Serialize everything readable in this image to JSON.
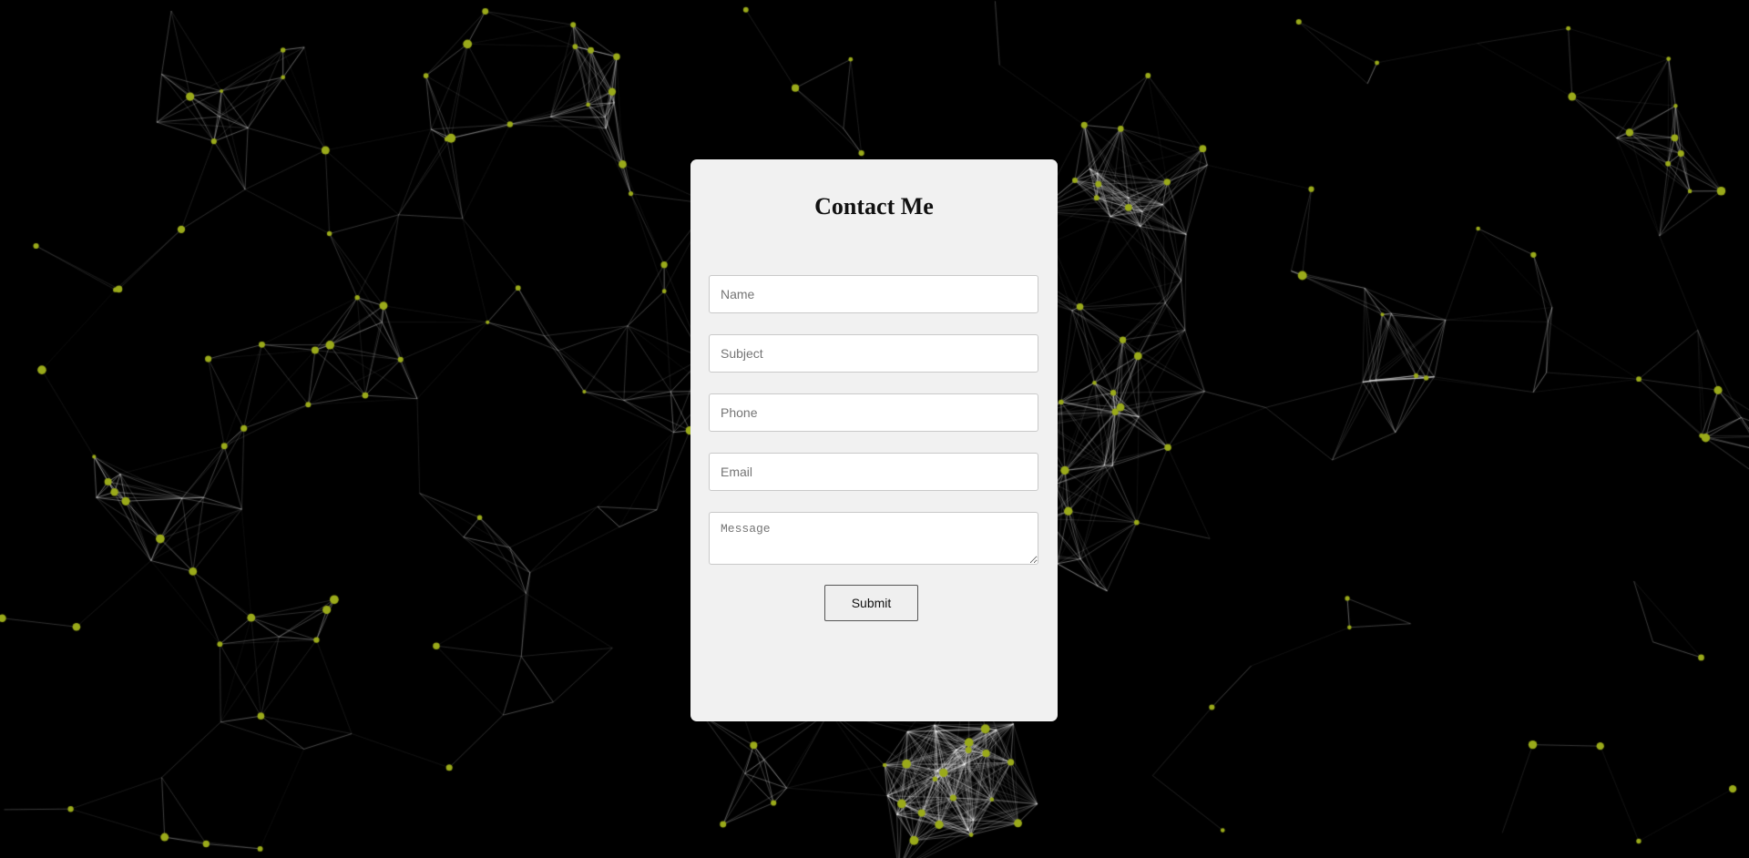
{
  "background": {
    "color": "#000000",
    "node_color": "#9aaa1a",
    "line_color": "#ffffff",
    "style": "particle-network"
  },
  "contact_form": {
    "title": "Contact Me",
    "fields": {
      "name": {
        "placeholder": "Name",
        "value": ""
      },
      "subject": {
        "placeholder": "Subject",
        "value": ""
      },
      "phone": {
        "placeholder": "Phone",
        "value": ""
      },
      "email": {
        "placeholder": "Email",
        "value": ""
      },
      "message": {
        "placeholder": "Message",
        "value": ""
      }
    },
    "submit_label": "Submit",
    "card_color": "#f1f1f1"
  }
}
